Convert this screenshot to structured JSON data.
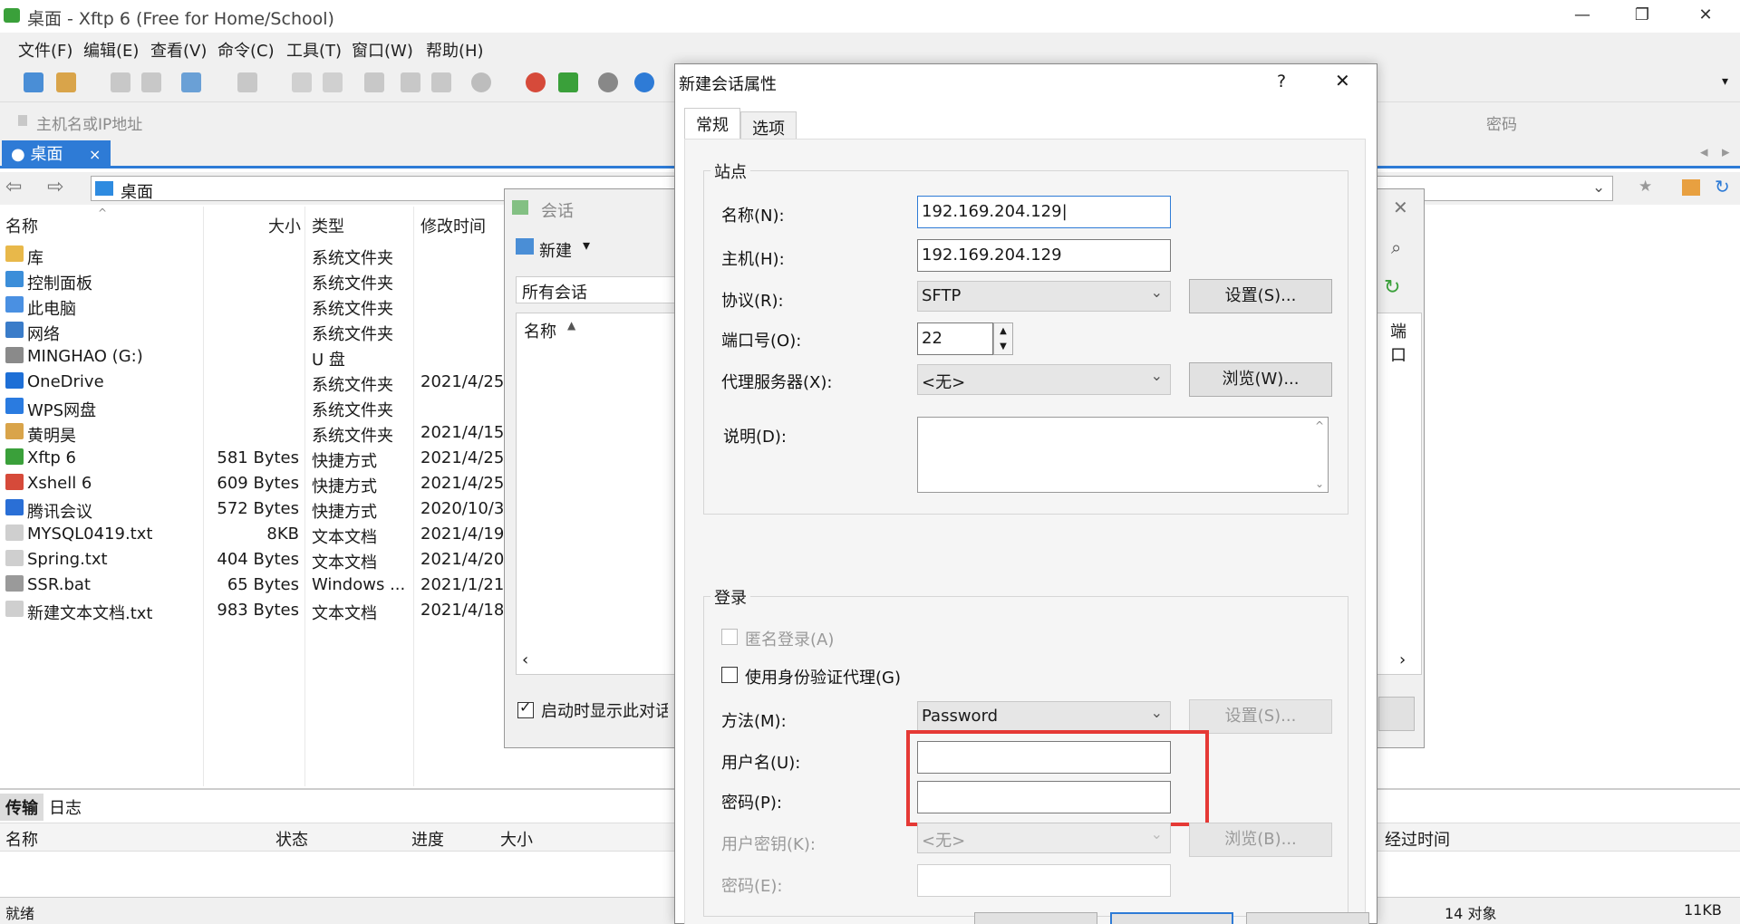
{
  "window": {
    "title": "桌面 - Xftp 6 (Free for Home/School)",
    "min": "—",
    "max": "❐",
    "close": "✕"
  },
  "menu": [
    "文件(F)",
    "编辑(E)",
    "查看(V)",
    "命令(C)",
    "工具(T)",
    "窗口(W)",
    "帮助(H)"
  ],
  "address": {
    "host_placeholder": "主机名或IP地址",
    "password_label": "密码"
  },
  "tab": {
    "label": "桌面",
    "close": "×"
  },
  "path": {
    "value": "桌面"
  },
  "filelist": {
    "headers": {
      "name": "名称",
      "size": "大小",
      "type": "类型",
      "modified": "修改时间"
    },
    "rows": [
      {
        "name": "库",
        "size": "",
        "type": "系统文件夹",
        "modified": "",
        "color": "#e8b84a"
      },
      {
        "name": "控制面板",
        "size": "",
        "type": "系统文件夹",
        "modified": "",
        "color": "#3c8ed9"
      },
      {
        "name": "此电脑",
        "size": "",
        "type": "系统文件夹",
        "modified": "",
        "color": "#4a90e2"
      },
      {
        "name": "网络",
        "size": "",
        "type": "系统文件夹",
        "modified": "",
        "color": "#3a7cc9"
      },
      {
        "name": "MINGHAO (G:)",
        "size": "",
        "type": "U 盘",
        "modified": "",
        "color": "#8a8a8a"
      },
      {
        "name": "OneDrive",
        "size": "",
        "type": "系统文件夹",
        "modified": "2021/4/25",
        "color": "#1e6fd6"
      },
      {
        "name": "WPS网盘",
        "size": "",
        "type": "系统文件夹",
        "modified": "",
        "color": "#2a7be0"
      },
      {
        "name": "黄明昊",
        "size": "",
        "type": "系统文件夹",
        "modified": "2021/4/15",
        "color": "#d9a44a"
      },
      {
        "name": "Xftp 6",
        "size": "581 Bytes",
        "type": "快捷方式",
        "modified": "2021/4/25",
        "color": "#3aa03a"
      },
      {
        "name": "Xshell 6",
        "size": "609 Bytes",
        "type": "快捷方式",
        "modified": "2021/4/25",
        "color": "#d64a3a"
      },
      {
        "name": "腾讯会议",
        "size": "572 Bytes",
        "type": "快捷方式",
        "modified": "2020/10/3",
        "color": "#2a6fd6"
      },
      {
        "name": "MYSQL0419.txt",
        "size": "8KB",
        "type": "文本文档",
        "modified": "2021/4/19",
        "color": "#cfcfcf"
      },
      {
        "name": "Spring.txt",
        "size": "404 Bytes",
        "type": "文本文档",
        "modified": "2021/4/20",
        "color": "#cfcfcf"
      },
      {
        "name": "SSR.bat",
        "size": "65 Bytes",
        "type": "Windows ...",
        "modified": "2021/1/21",
        "color": "#9a9a9a"
      },
      {
        "name": "新建文本文档.txt",
        "size": "983 Bytes",
        "type": "文本文档",
        "modified": "2021/4/18",
        "color": "#cfcfcf"
      }
    ]
  },
  "transfer": {
    "tabs": [
      "传输",
      "日志"
    ],
    "headers": {
      "name": "名称",
      "status": "状态",
      "progress": "进度",
      "size": "大小",
      "elapsed": "经过时间"
    }
  },
  "status": {
    "left": "就绪",
    "count": "14 对象",
    "size": "11KB"
  },
  "session_dialog": {
    "title": "会话",
    "new_label": "新建",
    "all_sessions": "所有会话",
    "name_header": "名称",
    "startup_checkbox": "启动时显示此对话框",
    "port_header_partial": "端口"
  },
  "props": {
    "title": "新建会话属性",
    "help": "?",
    "close": "✕",
    "tabs": [
      "常规",
      "选项"
    ],
    "site": {
      "group": "站点",
      "name_label": "名称(N):",
      "name_value": "192.169.204.129",
      "host_label": "主机(H):",
      "host_value": "192.169.204.129",
      "protocol_label": "协议(R):",
      "protocol_value": "SFTP",
      "settings_button": "设置(S)...",
      "port_label": "端口号(O):",
      "port_value": "22",
      "proxy_label": "代理服务器(X):",
      "proxy_value": "<无>",
      "browse_button": "浏览(W)...",
      "desc_label": "说明(D):",
      "desc_value": ""
    },
    "login": {
      "group": "登录",
      "anonymous_label": "匿名登录(A)",
      "agent_label": "使用身份验证代理(G)",
      "method_label": "方法(M):",
      "method_value": "Password",
      "method_settings": "设置(S)...",
      "username_label": "用户名(U):",
      "username_value": "",
      "password_label": "密码(P):",
      "password_value": "",
      "userkey_label": "用户密钥(K):",
      "userkey_value": "<无>",
      "userkey_browse": "浏览(B)...",
      "passphrase_label": "密码(E):",
      "passphrase_value": ""
    }
  },
  "colors": {
    "accent": "#2e7bd6",
    "highlight": "#e53935"
  }
}
